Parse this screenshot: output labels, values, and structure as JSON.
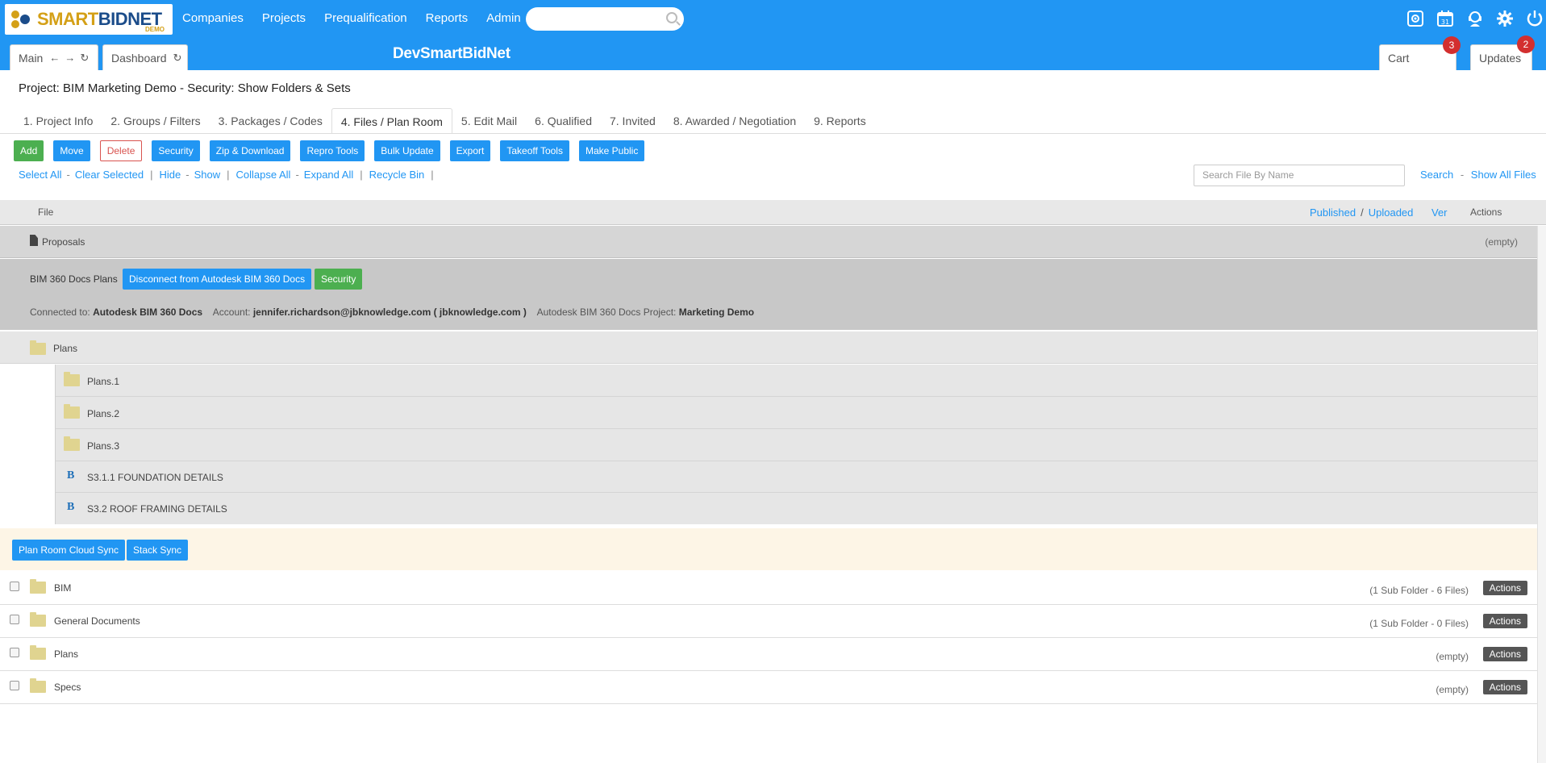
{
  "brand": {
    "smart": "SMART",
    "bidnet": "BIDNET",
    "demo": "DEMO"
  },
  "nav": [
    "Companies",
    "Projects",
    "Prequalification",
    "Reports",
    "Admin"
  ],
  "search_top": {
    "placeholder": ""
  },
  "top_icons": [
    "target-icon",
    "calendar-icon",
    "support-icon",
    "gear-icon",
    "power-icon"
  ],
  "calendar_day": "31",
  "tabs_top": {
    "main": "Main",
    "dashboard": "Dashboard"
  },
  "site_title": "DevSmartBidNet",
  "cart": {
    "label": "Cart",
    "count": "3"
  },
  "updates": {
    "label": "Updates",
    "count": "2"
  },
  "project_line": "Project: BIM Marketing Demo  - Security: Show Folders & Sets",
  "project_tabs": [
    {
      "label": "1. Project Info"
    },
    {
      "label": "2. Groups / Filters"
    },
    {
      "label": "3. Packages / Codes"
    },
    {
      "label": "4. Files / Plan Room",
      "active": true
    },
    {
      "label": "5. Edit Mail"
    },
    {
      "label": "6. Qualified"
    },
    {
      "label": "7. Invited"
    },
    {
      "label": "8. Awarded / Negotiation"
    },
    {
      "label": "9. Reports"
    }
  ],
  "toolbar": {
    "add": "Add",
    "move": "Move",
    "delete": "Delete",
    "security": "Security",
    "zip": "Zip & Download",
    "repro": "Repro Tools",
    "bulk": "Bulk Update",
    "export": "Export",
    "takeoff": "Takeoff Tools",
    "make_public": "Make Public"
  },
  "links": {
    "select_all": "Select All",
    "clear_selected": "Clear Selected",
    "hide": "Hide",
    "show": "Show",
    "collapse_all": "Collapse All",
    "expand_all": "Expand All",
    "recycle_bin": "Recycle Bin"
  },
  "file_search": {
    "placeholder": "Search File By Name"
  },
  "right_links": {
    "search": "Search",
    "show_all": "Show All Files"
  },
  "table_head": {
    "file": "File",
    "published": "Published",
    "uploaded": "Uploaded",
    "ver": "Ver",
    "actions": "Actions"
  },
  "proposals": {
    "label": "Proposals",
    "status": "(empty)"
  },
  "bim360": {
    "title": "BIM 360 Docs Plans",
    "disconnect": "Disconnect from Autodesk BIM 360 Docs",
    "security": "Security",
    "connected_label": "Connected to:",
    "connected_value": "Autodesk BIM 360 Docs",
    "account_label": "Account:",
    "account_value": "jennifer.richardson@jbknowledge.com ( jbknowledge.com )",
    "project_label": "Autodesk BIM 360 Docs Project:",
    "project_value": "Marketing Demo"
  },
  "plans_folder": "Plans",
  "sub_items": [
    {
      "label": "Plans.1",
      "kind": "folder"
    },
    {
      "label": "Plans.2",
      "kind": "folder"
    },
    {
      "label": "Plans.3",
      "kind": "folder"
    },
    {
      "label": "S3.1.1 FOUNDATION DETAILS",
      "kind": "bim"
    },
    {
      "label": "S3.2 ROOF FRAMING DETAILS",
      "kind": "bim"
    }
  ],
  "sync": {
    "cloud": "Plan Room Cloud Sync",
    "stack": "Stack Sync"
  },
  "folders": [
    {
      "label": "BIM",
      "meta": "(1 Sub Folder - 6 Files)",
      "action": "Actions"
    },
    {
      "label": "General Documents",
      "meta": "(1 Sub Folder - 0 Files)",
      "action": "Actions"
    },
    {
      "label": "Plans",
      "meta": "(empty)",
      "action": "Actions"
    },
    {
      "label": "Specs",
      "meta": "(empty)",
      "action": "Actions"
    }
  ]
}
